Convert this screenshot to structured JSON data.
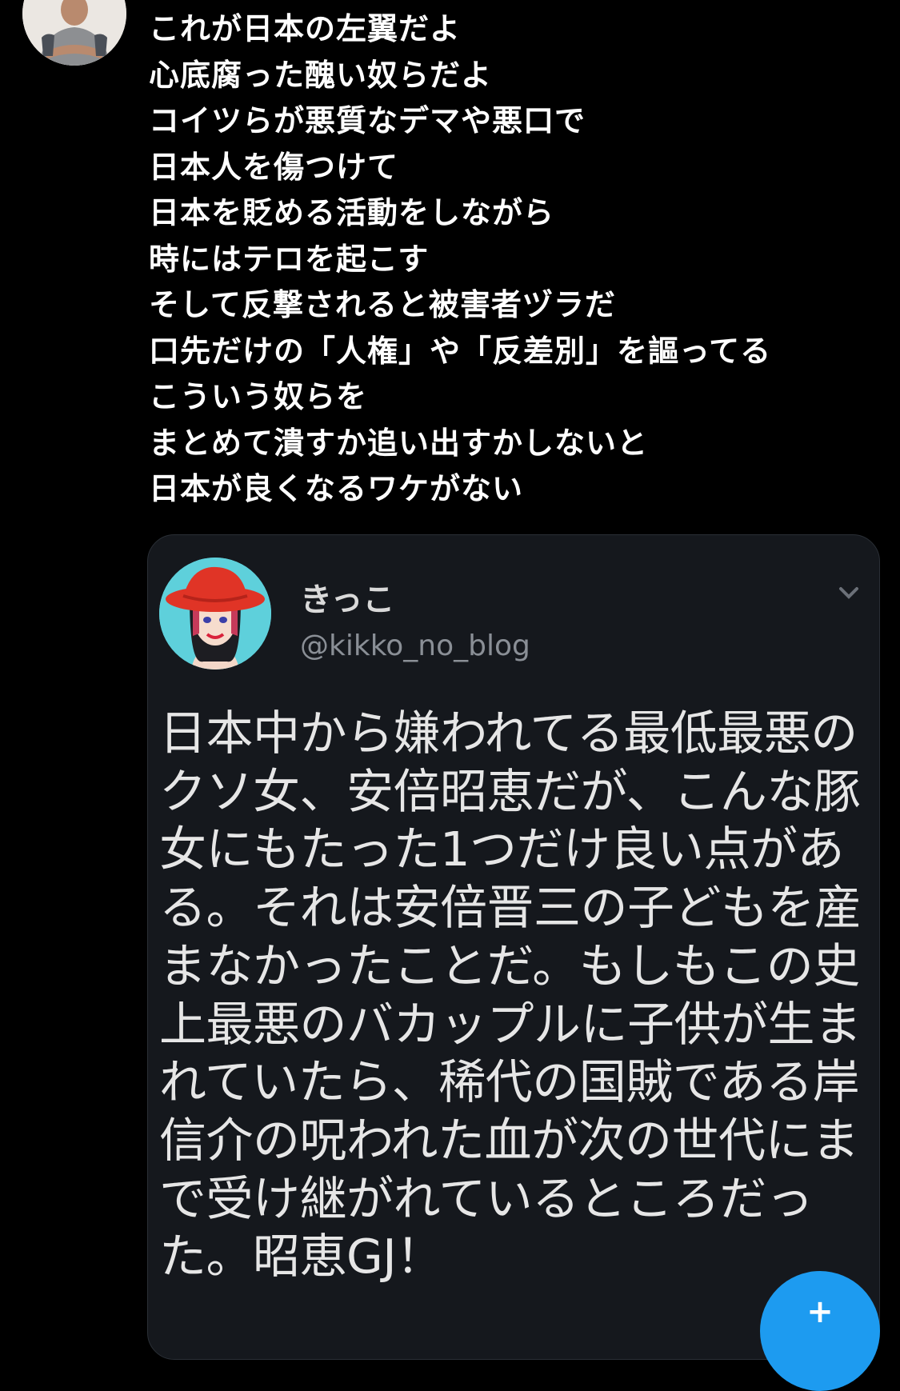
{
  "tweet": {
    "lines": [
      "これが日本の左翼だよ",
      "心底腐った醜い奴らだよ",
      "コイツらが悪質なデマや悪口で",
      "日本人を傷つけて",
      "日本を貶める活動をしながら",
      "時にはテロを起こす",
      "そして反撃されると被害者ヅラだ",
      "口先だけの「人権」や「反差別」を謳ってる",
      "こういう奴らを",
      "まとめて潰すか追い出すかしないと",
      "日本が良くなるワケがない"
    ]
  },
  "quoted_tweet": {
    "name": "きっこ",
    "handle": "@kikko_no_blog",
    "lines": [
      "日本中から嫌われてる最低最悪の",
      "クソ女、安倍昭恵だが、こんな豚",
      "女にもたった1つだけ良い点があ",
      "る。それは安倍晋三の子どもを産",
      "まなかったことだ。もしもこの史",
      "上最悪のバカップルに子供が生ま",
      "れていたら、稀代の国賊である岸",
      "信介の呪われた血が次の世代にま",
      "で受け継がれているところだっ",
      "た。昭恵GJ！"
    ]
  },
  "compose_button": {
    "icon": "plus-icon",
    "symbol": "+"
  },
  "colors": {
    "background": "#000000",
    "card_background": "#15181d",
    "accent": "#1d9bf0",
    "handle_text": "#8a8f96"
  }
}
